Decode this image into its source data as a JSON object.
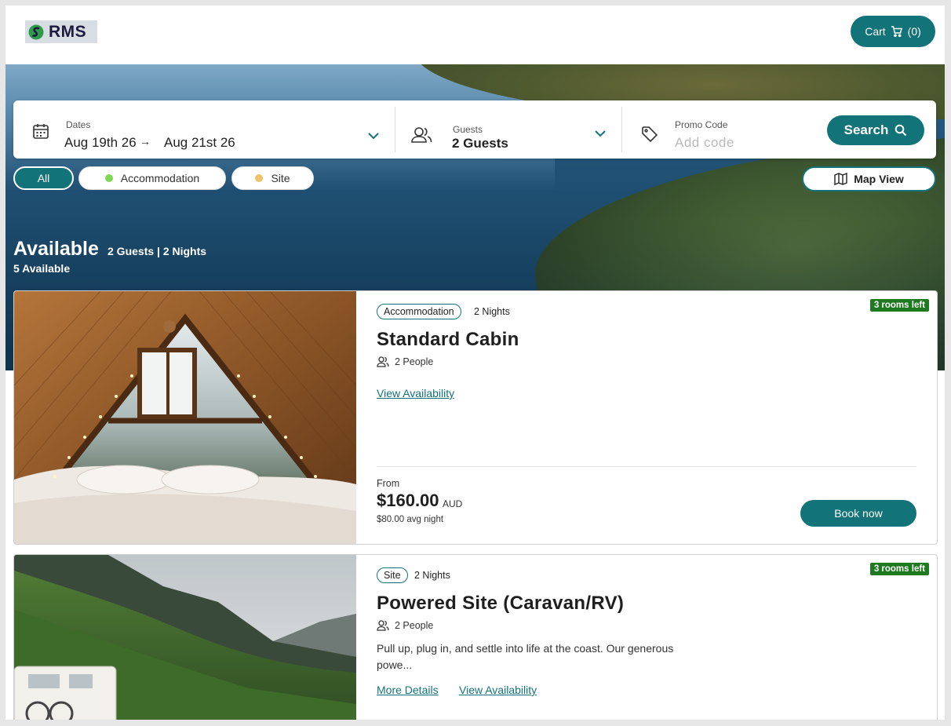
{
  "header": {
    "logo_text": "RMS",
    "cart_label": "Cart",
    "cart_count": "(0)"
  },
  "search": {
    "dates_label": "Dates",
    "date_from": "Aug 19th 26",
    "date_arrow": "→",
    "date_to": "Aug 21st 26",
    "guests_label": "Guests",
    "guests_value": "2 Guests",
    "promo_label": "Promo Code",
    "promo_placeholder": "Add code",
    "search_button": "Search"
  },
  "filters": {
    "all": "All",
    "accommodation": "Accommodation",
    "site": "Site",
    "map_view": "Map View",
    "accommodation_color": "#7ed957",
    "site_color": "#f0c36b"
  },
  "summary": {
    "title": "Available",
    "subtitle": "2 Guests | 2 Nights",
    "count": "5 Available"
  },
  "cards": [
    {
      "type": "Accommodation",
      "nights": "2 Nights",
      "rooms_left": "3 rooms left",
      "title": "Standard Cabin",
      "people": "2 People",
      "view_availability": "View Availability",
      "from_label": "From",
      "price": "$160.00",
      "currency": "AUD",
      "avg_night": "$80.00 avg night",
      "book_button": "Book now"
    },
    {
      "type": "Site",
      "nights": "2 Nights",
      "rooms_left": "3 rooms left",
      "title": "Powered Site (Caravan/RV)",
      "people": "2 People",
      "description": "Pull up, plug in, and settle into life at the coast. Our generous powe...",
      "more_details": "More Details",
      "view_availability": "View Availability"
    }
  ],
  "colors": {
    "accent": "#127378",
    "badge_green": "#1e7a1e"
  }
}
